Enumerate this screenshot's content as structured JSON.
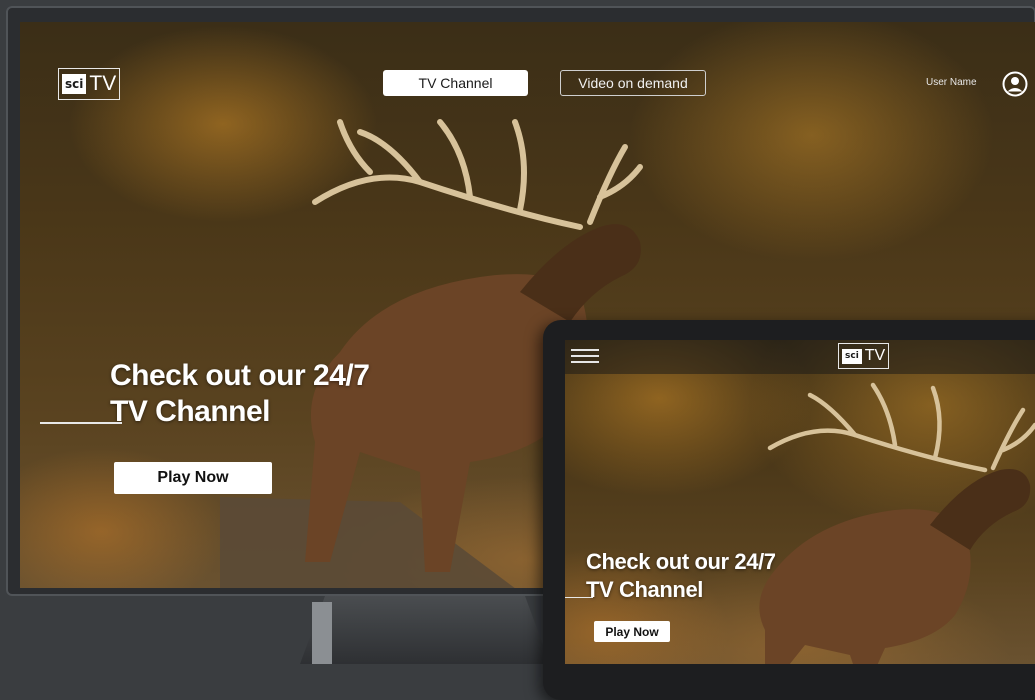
{
  "tv": {
    "logo": {
      "sci": "sci",
      "tv": "TV"
    },
    "nav": {
      "tv_channel": "TV Channel",
      "video_on_demand": "Video on demand"
    },
    "user": {
      "name": "User Name"
    },
    "hero": {
      "title_line1": "Check out our 24/7",
      "title_line2": "TV Channel",
      "play_label": "Play Now"
    }
  },
  "tablet": {
    "logo": {
      "sci": "sci",
      "tv": "TV"
    },
    "hero": {
      "title_line1": "Check out our 24/7",
      "title_line2": "TV Channel",
      "play_label": "Play Now"
    }
  },
  "icons": {
    "user": "user-circle-icon",
    "menu": "hamburger-menu-icon"
  },
  "colors": {
    "bezel": "#2b2d30",
    "button_bg": "#ffffff",
    "text": "#ffffff"
  }
}
